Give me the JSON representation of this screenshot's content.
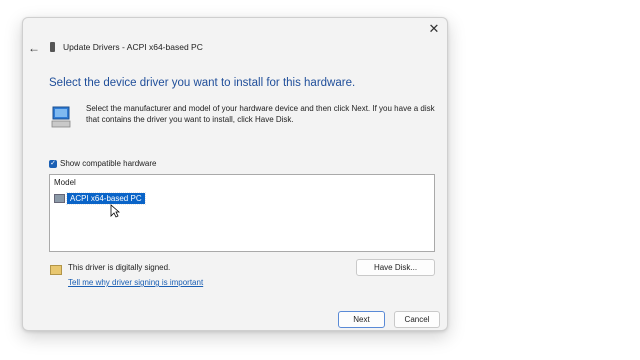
{
  "window": {
    "title": "Update Drivers - ACPI x64-based PC",
    "close_icon": "close-icon",
    "back_icon": "back-arrow-icon"
  },
  "main": {
    "heading": "Select the device driver you want to install for this hardware.",
    "description": "Select the manufacturer and model of your hardware device and then click Next. If you have a disk that contains the driver you want to install, click Have Disk.",
    "show_compatible_label": "Show compatible hardware",
    "show_compatible_checked": true,
    "model_list": {
      "header": "Model",
      "items": [
        {
          "label": "ACPI x64-based PC",
          "selected": true
        }
      ]
    },
    "signed_text": "This driver is digitally signed.",
    "signing_link": "Tell me why driver signing is important",
    "have_disk_label": "Have Disk..."
  },
  "footer": {
    "next_label": "Next",
    "cancel_label": "Cancel"
  },
  "colors": {
    "heading": "#1f4e9a",
    "selection": "#0a64c8",
    "link": "#1a5fb4"
  }
}
